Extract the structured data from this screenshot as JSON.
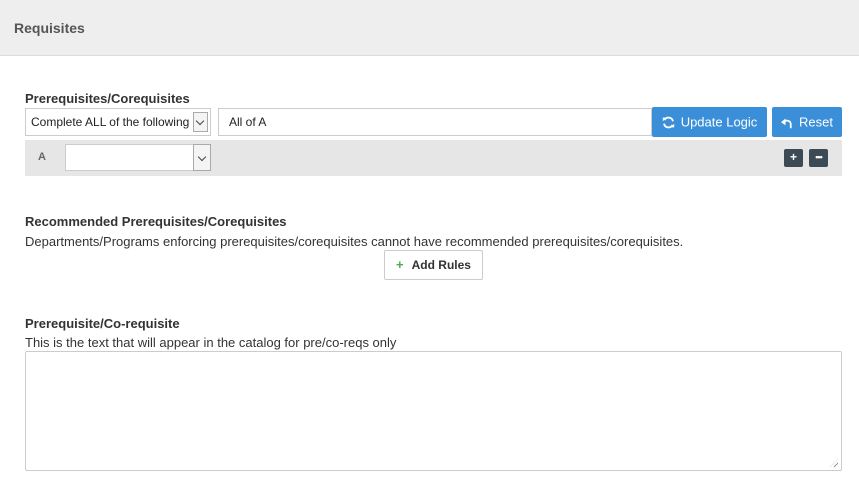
{
  "panel": {
    "title": "Requisites"
  },
  "prereq": {
    "label": "Prerequisites/Corequisites",
    "logic_select_value": "Complete ALL of the following",
    "logic_input_value": "All of A",
    "update_button": "Update Logic",
    "reset_button": "Reset",
    "rule_row": {
      "letter": "A",
      "select_value": ""
    },
    "add_button_icon": "plus-icon",
    "more_button_icon": "ellipsis-icon"
  },
  "recommended": {
    "label": "Recommended Prerequisites/Corequisites",
    "help": "Departments/Programs enforcing prerequisites/corequisites cannot have recommended prerequisites/corequisites.",
    "add_rules_button": "Add Rules"
  },
  "catalog_text": {
    "label": "Prerequisite/Co-requisite",
    "help": "This is the text that will appear in the catalog for pre/co-reqs only",
    "value": ""
  },
  "colors": {
    "accent": "#3b8fd9",
    "dark_button": "#3c4a56",
    "add_green": "#4cae4c",
    "header_bg": "#eeeeee"
  }
}
